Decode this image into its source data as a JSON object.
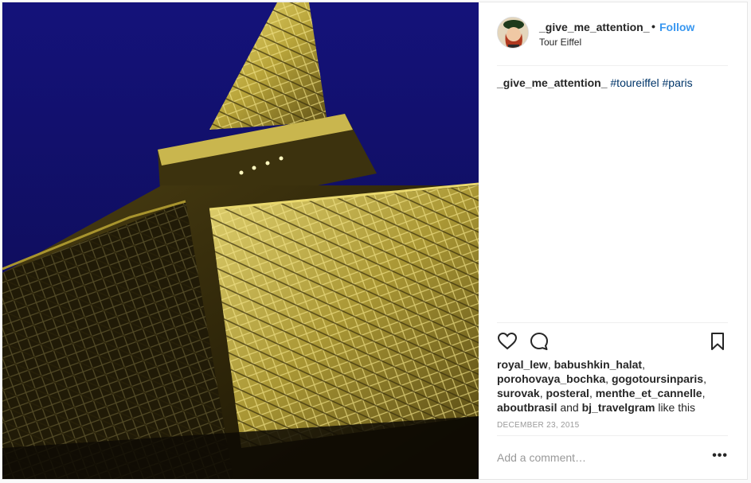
{
  "post": {
    "username": "_give_me_attention_",
    "dot": "•",
    "follow_label": "Follow",
    "location": "Tour Eiffel",
    "caption": {
      "username": "_give_me_attention_",
      "hashtags": [
        "#toureiffel",
        "#paris"
      ]
    },
    "icons": {
      "like": "heart-icon",
      "comment": "speech-bubble-icon",
      "save": "bookmark-icon",
      "options": "ellipsis-icon"
    },
    "likes": {
      "users": [
        "royal_lew",
        "babushkin_halat",
        "porohovaya_bochka",
        "gogotoursinparis",
        "surovak",
        "posteral",
        "menthe_et_cannelle",
        "aboutbrasil"
      ],
      "and_text": "and",
      "last_user": "bj_travelgram",
      "suffix": "like this"
    },
    "date": "DECEMBER 23, 2015",
    "comment_placeholder": "Add a comment…",
    "more_label": "•••"
  },
  "colors": {
    "link_blue": "#3897f0",
    "hashtag": "#003569",
    "sky": "#12115e",
    "tower_light": "#e8d36a"
  }
}
